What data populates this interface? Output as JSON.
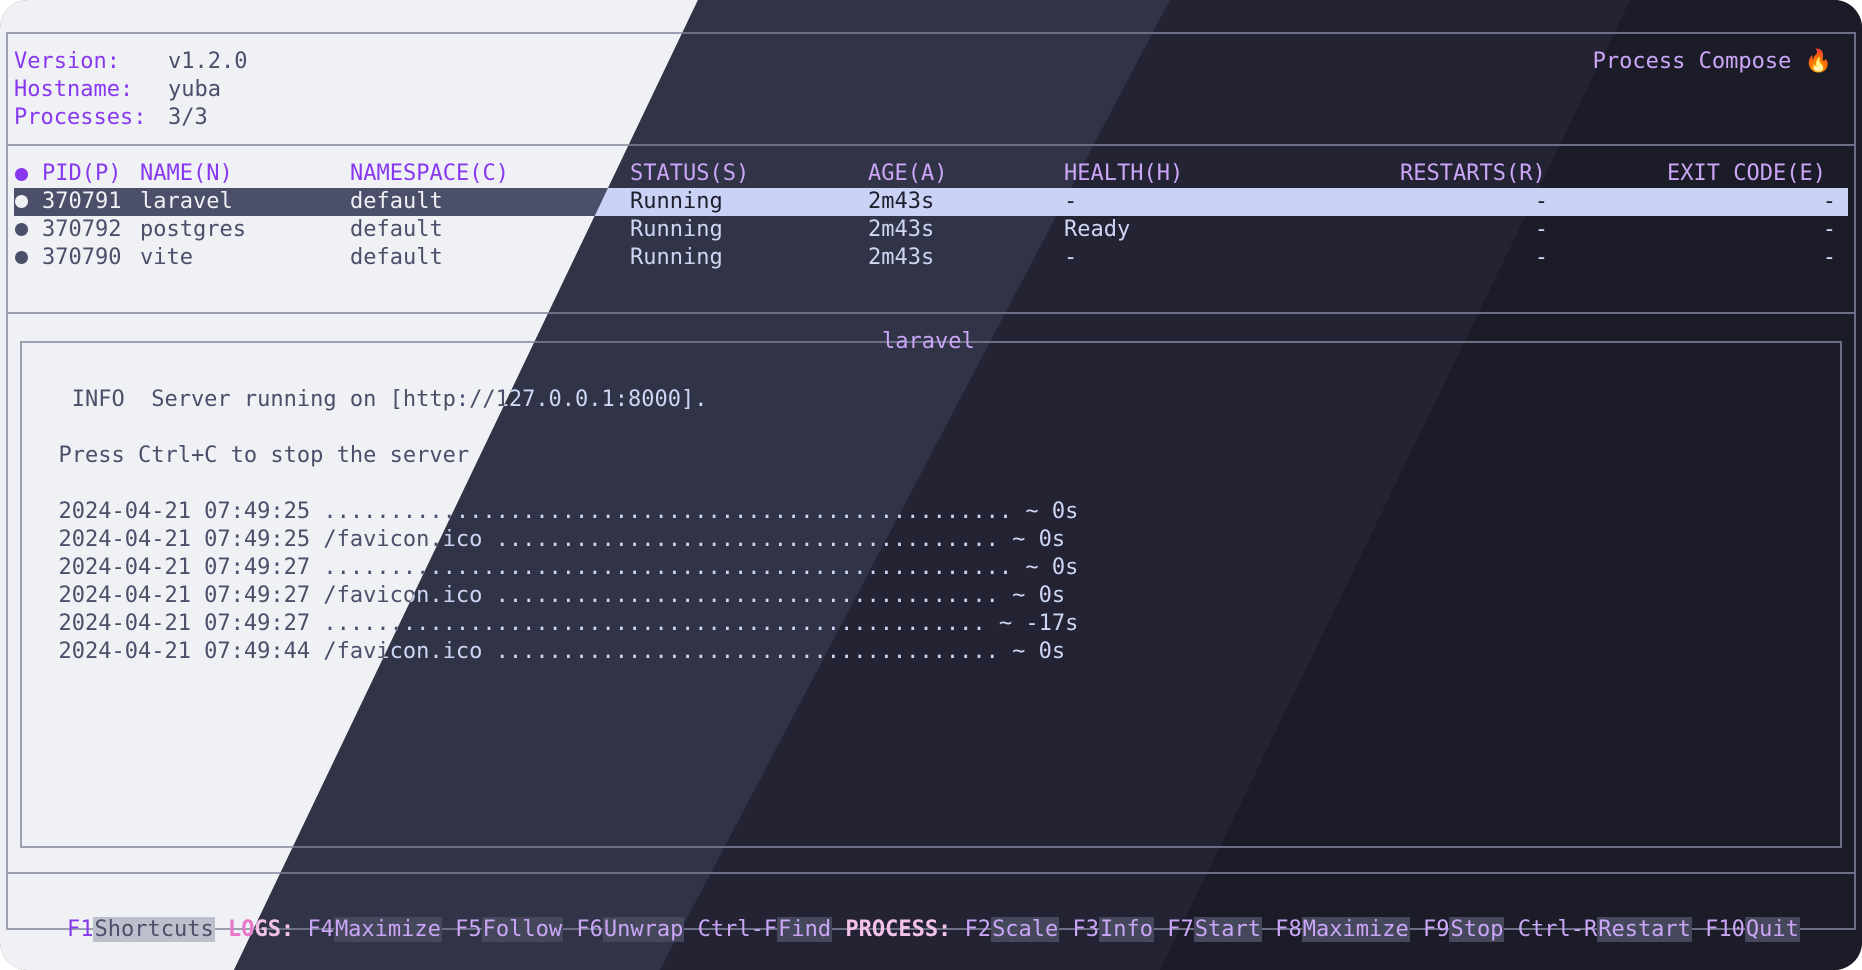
{
  "app": {
    "title": "Process Compose 🔥"
  },
  "info": {
    "version_label": "Version:",
    "version": "v1.2.0",
    "hostname_label": "Hostname:",
    "hostname": "yuba",
    "processes_label": "Processes:",
    "processes": "3/3"
  },
  "table": {
    "headers": {
      "pid": "PID(P)",
      "name": "NAME(N)",
      "namespace": "NAMESPACE(C)",
      "status": "STATUS(S)",
      "age": "AGE(A)",
      "health": "HEALTH(H)",
      "restarts": "RESTARTS(R)",
      "exit_code": "EXIT CODE(E)"
    },
    "rows": [
      {
        "pid": "370791",
        "name": "laravel",
        "namespace": "default",
        "status": "Running",
        "age": "2m43s",
        "health": "-",
        "restarts": "-",
        "exit_code": "-"
      },
      {
        "pid": "370792",
        "name": "postgres",
        "namespace": "default",
        "status": "Running",
        "age": "2m43s",
        "health": "Ready",
        "restarts": "-",
        "exit_code": "-"
      },
      {
        "pid": "370790",
        "name": "vite",
        "namespace": "default",
        "status": "Running",
        "age": "2m43s",
        "health": "-",
        "restarts": "-",
        "exit_code": "-"
      }
    ],
    "selected_index": 0
  },
  "logs": {
    "title": "laravel",
    "lines": [
      "   INFO  Server running on [http://127.0.0.1:8000].",
      "",
      "  Press Ctrl+C to stop the server",
      "",
      "  2024-04-21 07:49:25 .................................................... ~ 0s",
      "  2024-04-21 07:49:25 /favicon.ico ...................................... ~ 0s",
      "  2024-04-21 07:49:27 .................................................... ~ 0s",
      "  2024-04-21 07:49:27 /favicon.ico ...................................... ~ 0s",
      "  2024-04-21 07:49:27 .................................................. ~ -17s",
      "  2024-04-21 07:49:44 /favicon.ico ...................................... ~ 0s"
    ]
  },
  "footer": {
    "shortcuts": {
      "key": "F1",
      "label": "Shortcuts"
    },
    "logs_group": "LOGS:",
    "logs_keys": [
      {
        "key": "F4",
        "label": "Maximize"
      },
      {
        "key": "F5",
        "label": "Follow"
      },
      {
        "key": "F6",
        "label": "Unwrap"
      },
      {
        "key": "Ctrl-F",
        "label": "Find"
      }
    ],
    "process_group": "PROCESS:",
    "process_keys": [
      {
        "key": "F2",
        "label": "Scale"
      },
      {
        "key": "F3",
        "label": "Info"
      },
      {
        "key": "F7",
        "label": "Start"
      },
      {
        "key": "F8",
        "label": "Maximize"
      },
      {
        "key": "F9",
        "label": "Stop"
      },
      {
        "key": "Ctrl-R",
        "label": "Restart"
      },
      {
        "key": "F10",
        "label": "Quit"
      }
    ]
  },
  "theme": {
    "light_bg": "#eff1f5",
    "dark_bg": "#1e1e2e",
    "accent_light": "#8839ef",
    "accent_dark": "#cba6f7"
  }
}
